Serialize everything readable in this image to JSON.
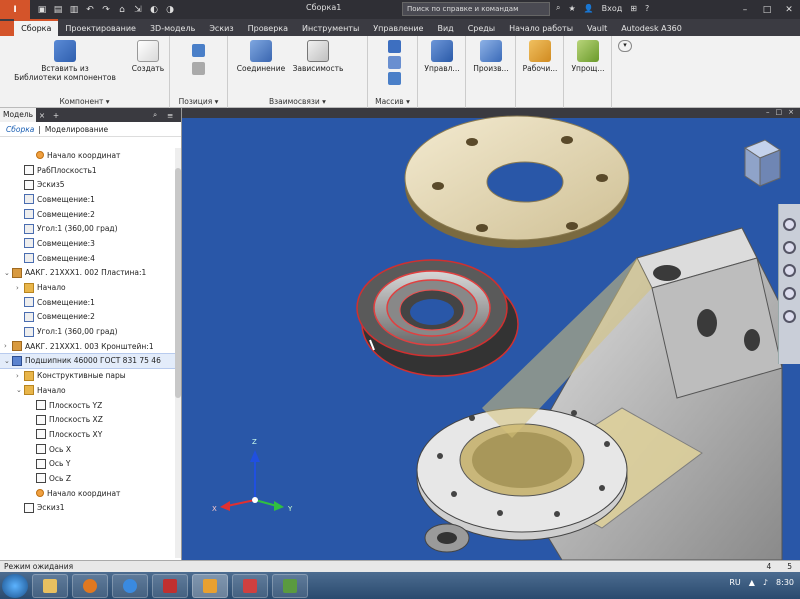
{
  "window": {
    "app_button": "I",
    "doc_title": "Сборка1",
    "help_search": "Поиск по справке и командам",
    "sign_in": "Вход",
    "controls": [
      "–",
      "□",
      "✕"
    ]
  },
  "tabs": [
    {
      "label": "Сборка",
      "active": true
    },
    {
      "label": "Проектирование"
    },
    {
      "label": "3D-модель"
    },
    {
      "label": "Эскиз"
    },
    {
      "label": "Проверка"
    },
    {
      "label": "Инструменты"
    },
    {
      "label": "Управление"
    },
    {
      "label": "Вид"
    },
    {
      "label": "Среды"
    },
    {
      "label": "Начало работы"
    },
    {
      "label": "Vault"
    },
    {
      "label": "Autodesk A360"
    }
  ],
  "ribbon": {
    "component": {
      "insert_label": "Вставить из\nБиблиотеки компонентов",
      "create_label": "Создать",
      "panel_label": "Компонент ▾"
    },
    "position": {
      "panel_label": "Позиция ▾"
    },
    "relations": {
      "joint_label": "Соединение",
      "constraint_label": "Зависимость",
      "panel_label": "Взаимосвязи ▾"
    },
    "pattern": {
      "panel_label": "Массив ▾"
    },
    "manage_label": "Управл...",
    "productivity_label": "Произв...",
    "workplane_label": "Рабочи...",
    "simplify_label": "Упрощ..."
  },
  "browser": {
    "tab_label": "Модель",
    "subtab_assembly": "Сборка",
    "subtab_modeling": "Моделирование",
    "tree": [
      {
        "label": "Начало координат",
        "indent": 2,
        "icon": "origin"
      },
      {
        "label": "РабПлоскость1",
        "indent": 1,
        "icon": "plane"
      },
      {
        "label": "Эскиз5",
        "indent": 1,
        "icon": "plane"
      },
      {
        "label": "Совмещение:1",
        "indent": 1,
        "icon": "cons"
      },
      {
        "label": "Совмещение:2",
        "indent": 1,
        "icon": "cons"
      },
      {
        "label": "Угол:1 (360,00 град)",
        "indent": 1,
        "icon": "cons"
      },
      {
        "label": "Совмещение:3",
        "indent": 1,
        "icon": "cons"
      },
      {
        "label": "Совмещение:4",
        "indent": 1,
        "icon": "cons"
      },
      {
        "label": "ААКГ. 21ХХХ1. 002 Пластина:1",
        "indent": 0,
        "icon": "asm",
        "exp": "⌄"
      },
      {
        "label": "Начало",
        "indent": 1,
        "icon": "folder",
        "exp": "›"
      },
      {
        "label": "Совмещение:1",
        "indent": 1,
        "icon": "cons"
      },
      {
        "label": "Совмещение:2",
        "indent": 1,
        "icon": "cons"
      },
      {
        "label": "Угол:1 (360,00 град)",
        "indent": 1,
        "icon": "cons"
      },
      {
        "label": "ААКГ. 21ХХХ1. 003 Кронштейн:1",
        "indent": 0,
        "icon": "asm",
        "exp": "›"
      },
      {
        "label": "Подшипник 46000 ГОСТ 831 75 46",
        "indent": 0,
        "icon": "hl",
        "exp": "⌄",
        "hilite": true
      },
      {
        "label": "Конструктивные пары",
        "indent": 1,
        "icon": "folder",
        "exp": "›"
      },
      {
        "label": "Начало",
        "indent": 1,
        "icon": "folder",
        "exp": "⌄"
      },
      {
        "label": "Плоскость YZ",
        "indent": 2,
        "icon": "plane"
      },
      {
        "label": "Плоскость XZ",
        "indent": 2,
        "icon": "plane"
      },
      {
        "label": "Плоскость XY",
        "indent": 2,
        "icon": "plane"
      },
      {
        "label": "Ось X",
        "indent": 2,
        "icon": "plane"
      },
      {
        "label": "Ось Y",
        "indent": 2,
        "icon": "plane"
      },
      {
        "label": "Ось Z",
        "indent": 2,
        "icon": "plane"
      },
      {
        "label": "Начало координат",
        "indent": 2,
        "icon": "origin"
      },
      {
        "label": "Эскиз1",
        "indent": 1,
        "icon": "plane"
      }
    ]
  },
  "viewport": {
    "axis_x": "X",
    "axis_y": "Y",
    "axis_z": "Z",
    "viewcube_colors": [
      "#8fa3c9",
      "#c4d2ec",
      "#6f86b4"
    ]
  },
  "status": {
    "text": "Режим ожидания",
    "num1": "4",
    "num2": "5"
  },
  "taskbar": {
    "lang": "RU",
    "time": "8:30"
  },
  "colors": {
    "accent": "#d4542a",
    "viewport_bg": "#2957a8",
    "flange": "#e8dcb5",
    "bearing": "#d03030",
    "bracket": "#c9b77a"
  }
}
